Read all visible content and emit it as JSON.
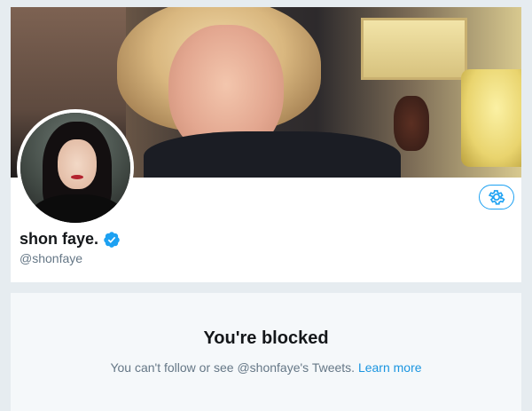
{
  "profile": {
    "display_name": "shon faye.",
    "handle": "@shonfaye",
    "verified": true
  },
  "blocked": {
    "title": "You're blocked",
    "message": "You can't follow or see @shonfaye's Tweets.",
    "link_label": "Learn more"
  },
  "icons": {
    "settings": "gear-icon",
    "verified": "verified-badge-icon"
  },
  "colors": {
    "accent": "#1da1f2",
    "link": "#1b95e0",
    "text_primary": "#14171a",
    "text_secondary": "#657786",
    "page_bg": "#e6ecf0",
    "blocked_bg": "#f5f8fa"
  }
}
